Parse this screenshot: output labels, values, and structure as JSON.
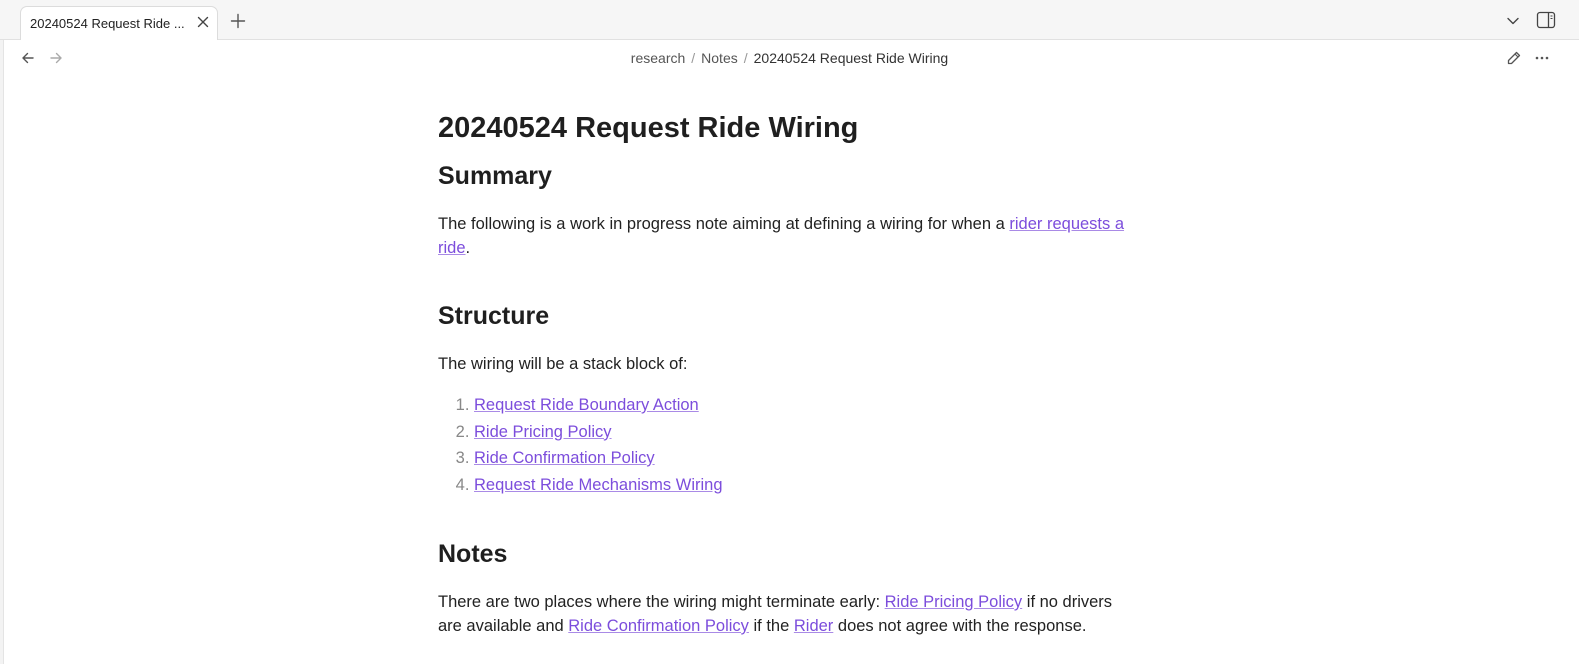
{
  "tab": {
    "title": "20240524 Request Ride ...",
    "close_icon": "close-icon"
  },
  "toolbar": {
    "new_tab_icon": "plus-icon",
    "tab_list_icon": "chevron-down-icon",
    "sidebar_icon": "sidebar-toggle-icon",
    "back_icon": "arrow-left-icon",
    "forward_icon": "arrow-right-icon",
    "edit_icon": "pencil-icon",
    "more_icon": "more-horizontal-icon"
  },
  "breadcrumb": {
    "items": [
      "research",
      "Notes",
      "20240524 Request Ride Wiring"
    ],
    "separator": "/"
  },
  "note": {
    "title": "20240524 Request Ride Wiring",
    "summary_heading": "Summary",
    "summary_text": "The following is a work in progress note aiming at defining a wiring for when a ",
    "summary_link": "rider requests a ride",
    "summary_end": ".",
    "structure_heading": "Structure",
    "structure_text": "The wiring will be a stack block of:",
    "structure_items": [
      "Request Ride Boundary Action",
      "Ride Pricing Policy",
      "Ride Confirmation Policy",
      "Request Ride Mechanisms Wiring"
    ],
    "notes_heading": "Notes",
    "notes_text_1": "There are two places where the wiring might terminate early: ",
    "notes_link_1": "Ride Pricing Policy",
    "notes_text_2": " if no drivers are available and ",
    "notes_link_2": "Ride Confirmation Policy",
    "notes_text_3": " if the ",
    "notes_link_3": "Rider",
    "notes_text_4": " does not agree with the response."
  },
  "colors": {
    "link": "#7c4ddc",
    "text": "#222222",
    "tabbar_bg": "#f6f6f6"
  }
}
